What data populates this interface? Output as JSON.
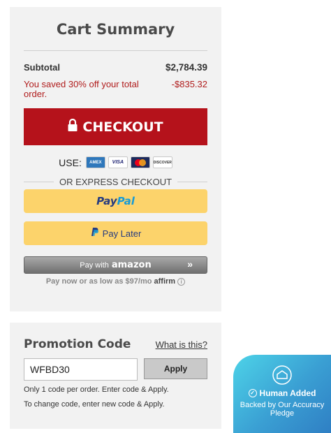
{
  "cart": {
    "title": "Cart Summary",
    "subtotal_label": "Subtotal",
    "subtotal_value": "$2,784.39",
    "savings_label": "You saved 30% off your total order.",
    "savings_value": "-$835.32",
    "checkout_label": "CHECKOUT",
    "use_label": "USE:",
    "cards": [
      "AMEX",
      "VISA",
      "MC",
      "DISCOVER"
    ],
    "express_label": "OR EXPRESS CHECKOUT",
    "paypal_part1": "Pay",
    "paypal_part2": "Pal",
    "paylater_label": "Pay Later",
    "amazon_prefix": "Pay with",
    "amazon_brand": "amazon",
    "amazon_arrows": "»",
    "affirm_text": "Pay now or as low as $97/mo",
    "affirm_brand": "affirm",
    "affirm_info": "i"
  },
  "promo": {
    "title": "Promotion Code",
    "what_link": "What is this?",
    "input_value": "WFBD30",
    "apply_label": "Apply",
    "note1": "Only 1 code per order. Enter code & Apply.",
    "note2": "To change code, enter new code & Apply."
  },
  "badge": {
    "heading": "Human Added",
    "subtext": "Backed by Our Accuracy Pledge"
  },
  "colors": {
    "checkout": "#b5121b",
    "savings": "#b01c1c",
    "paypal_button": "#fcd36b",
    "badge": "#3a9fd3"
  }
}
